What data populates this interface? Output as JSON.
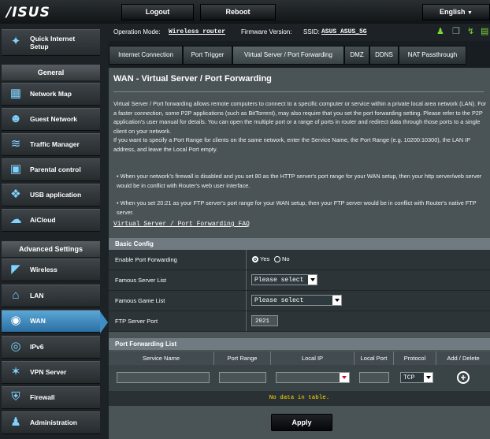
{
  "brand": "/ISUS",
  "topbar": {
    "logout": "Logout",
    "reboot": "Reboot",
    "language": "English"
  },
  "status": {
    "op_mode_label": "Operation Mode:",
    "op_mode_value": "Wireless router",
    "fw_label": "Firmware Version:",
    "ssid_label": "SSID:",
    "ssid_values": "ASUS  ASUS_5G"
  },
  "sidebar": {
    "quick_setup": "Quick Internet Setup",
    "general": "General",
    "general_items": [
      "Network Map",
      "Guest Network",
      "Traffic Manager",
      "Parental control",
      "USB application",
      "AiCloud"
    ],
    "advanced": "Advanced Settings",
    "advanced_items": [
      "Wireless",
      "LAN",
      "WAN",
      "IPv6",
      "VPN Server",
      "Firewall",
      "Administration"
    ]
  },
  "tabs": [
    "Internet Connection",
    "Port Trigger",
    "Virtual Server / Port Forwarding",
    "DMZ",
    "DDNS",
    "NAT Passthrough"
  ],
  "page": {
    "title": "WAN - Virtual Server / Port Forwarding",
    "desc1": "Virtual Server / Port forwarding allows remote computers to connect to a specific computer or service within a private local area network (LAN). For a faster connection, some P2P applications (such as BitTorrent), may also require that you set the port forwarding setting. Please refer to the P2P application's user manual for details. You can open the multiple port or a range of ports in router and redirect data through those ports to a single client on your network.",
    "desc2": "If you want to specify a Port Range for clients on the same network, enter the Service Name, the Port Range (e.g. 10200:10300), the LAN IP address, and leave the Local Port empty.",
    "bullet1": "When your network's firewall is disabled and you set 80 as the HTTP server's port range for your WAN setup, then your http server/web server would be in conflict with Router's web user interface.",
    "bullet2": "When you set 20:21 as your FTP server's port range for your WAN setup, then your FTP server would be in conflict with Router's native FTP server.",
    "faq": "Virtual Server / Port Forwarding FAQ"
  },
  "basic": {
    "header": "Basic Config",
    "enable_label": "Enable Port Forwarding",
    "yes": "Yes",
    "no": "No",
    "server_label": "Famous Server List",
    "server_value": "Please select",
    "game_label": "Famous Game List",
    "game_value": "Please select",
    "ftp_label": "FTP Server Port",
    "ftp_value": "2021"
  },
  "pf": {
    "header": "Port Forwarding List",
    "columns": [
      "Service Name",
      "Port Range",
      "Local IP",
      "Local Port",
      "Protocol",
      "Add / Delete"
    ],
    "protocol_value": "TCP",
    "no_data": "No data in table."
  },
  "apply": "Apply"
}
